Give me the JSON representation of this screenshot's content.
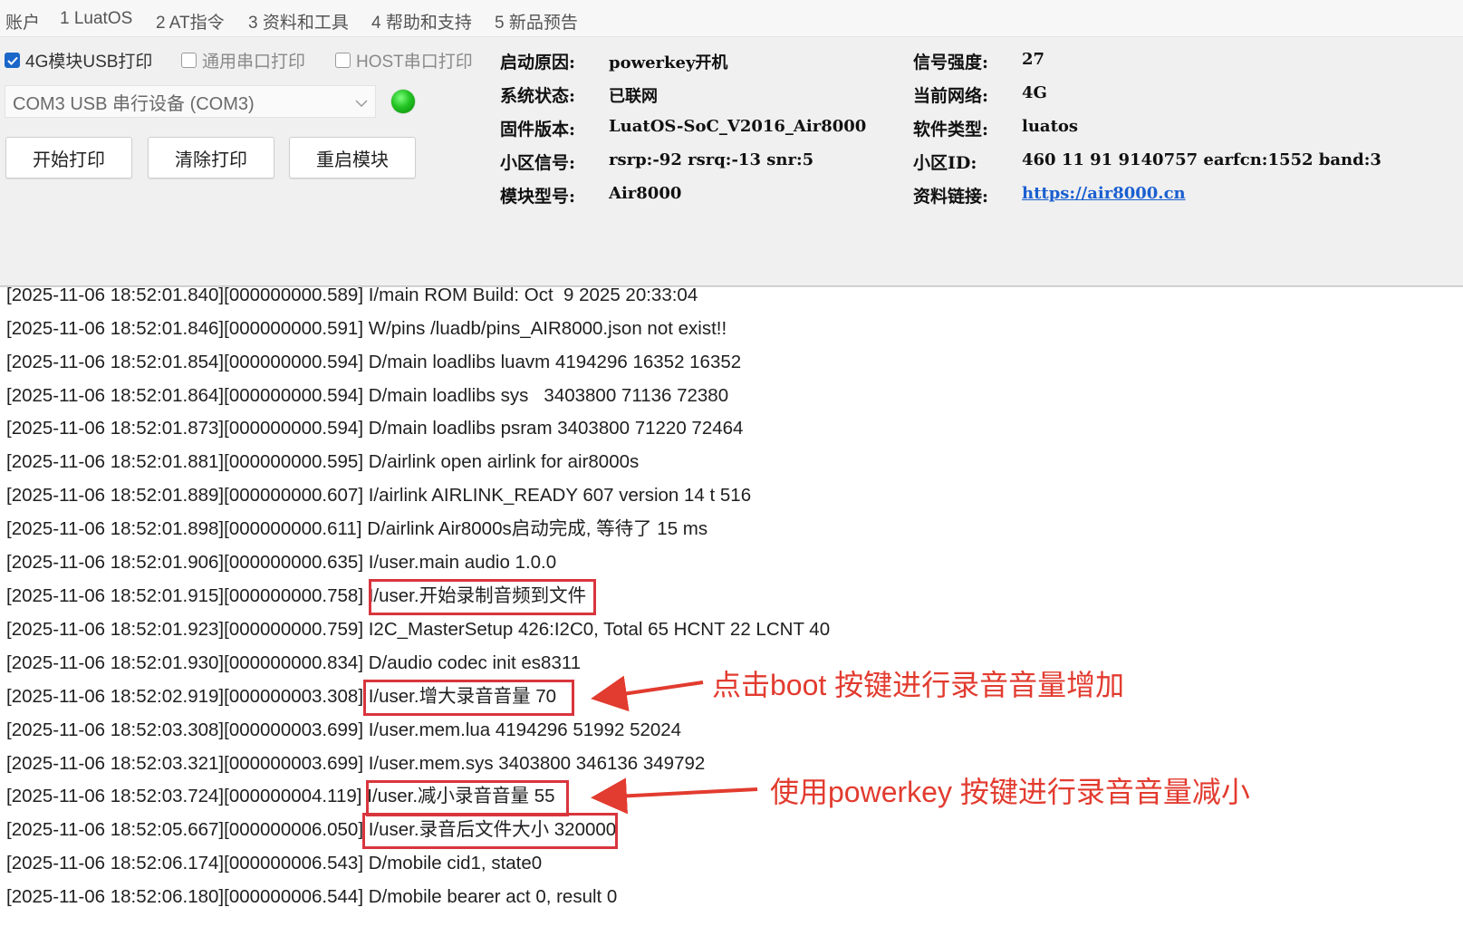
{
  "menu": [
    "账户",
    "1 LuatOS",
    "2 AT指令",
    "3 资料和工具",
    "4 帮助和支持",
    "5 新品预告"
  ],
  "panel": {
    "checkboxes": [
      {
        "label": "4G模块USB打印",
        "checked": true
      },
      {
        "label": "通用串口打印",
        "checked": false
      },
      {
        "label": "HOST串口打印",
        "checked": false
      }
    ],
    "port_select": "COM3 USB 串行设备 (COM3)",
    "led_color": "#22c322",
    "buttons": [
      "开始打印",
      "清除打印",
      "重启模块"
    ]
  },
  "info": {
    "boot_reason": {
      "label": "启动原因:",
      "value": "powerkey开机"
    },
    "system_state": {
      "label": "系统状态:",
      "value": "已联网"
    },
    "firmware": {
      "label": "固件版本:",
      "value": "LuatOS-SoC_V2016_Air8000"
    },
    "cell_signal": {
      "label": "小区信号:",
      "value": "rsrp:-92 rsrq:-13 snr:5"
    },
    "module_model": {
      "label": "模块型号:",
      "value": "Air8000"
    },
    "signal_strength": {
      "label": "信号强度:",
      "value": "27"
    },
    "network": {
      "label": "当前网络:",
      "value": "4G"
    },
    "software_type": {
      "label": "软件类型:",
      "value": "luatos"
    },
    "cell_id": {
      "label": "小区ID:",
      "value": "460 11 91 9140757 earfcn:1552 band:3"
    },
    "docs_link": {
      "label": "资料链接:",
      "value": "https://air8000.cn"
    }
  },
  "log": [
    {
      "prefix": "[2025-11-06 18:52:01.840][000000000.589] ",
      "msg": "I/main ROM Build: Oct  9 2025 20:33:04"
    },
    {
      "prefix": "[2025-11-06 18:52:01.846][000000000.591] ",
      "msg": "W/pins /luadb/pins_AIR8000.json not exist!!"
    },
    {
      "prefix": "[2025-11-06 18:52:01.854][000000000.594] ",
      "msg": "D/main loadlibs luavm 4194296 16352 16352"
    },
    {
      "prefix": "[2025-11-06 18:52:01.864][000000000.594] ",
      "msg": "D/main loadlibs sys   3403800 71136 72380"
    },
    {
      "prefix": "[2025-11-06 18:52:01.873][000000000.594] ",
      "msg": "D/main loadlibs psram 3403800 71220 72464"
    },
    {
      "prefix": "[2025-11-06 18:52:01.881][000000000.595] ",
      "msg": "D/airlink open airlink for air8000s"
    },
    {
      "prefix": "[2025-11-06 18:52:01.889][000000000.607] ",
      "msg": "I/airlink AIRLINK_READY 607 version 14 t 516"
    },
    {
      "prefix": "[2025-11-06 18:52:01.898][000000000.611] ",
      "msg": "D/airlink Air8000s启动完成, 等待了 15 ms"
    },
    {
      "prefix": "[2025-11-06 18:52:01.906][000000000.635] ",
      "msg": "I/user.main audio 1.0.0"
    },
    {
      "prefix": "[2025-11-06 18:52:01.915][000000000.758] ",
      "msg": "I/user.开始录制音频到文件"
    },
    {
      "prefix": "[2025-11-06 18:52:01.923][000000000.759] ",
      "msg": "I2C_MasterSetup 426:I2C0, Total 65 HCNT 22 LCNT 40"
    },
    {
      "prefix": "[2025-11-06 18:52:01.930][000000000.834] ",
      "msg": "D/audio codec init es8311"
    },
    {
      "prefix": "[2025-11-06 18:52:02.919][000000003.308] ",
      "msg": "I/user.增大录音音量 70"
    },
    {
      "prefix": "[2025-11-06 18:52:03.308][000000003.699] ",
      "msg": "I/user.mem.lua 4194296 51992 52024"
    },
    {
      "prefix": "[2025-11-06 18:52:03.321][000000003.699] ",
      "msg": "I/user.mem.sys 3403800 346136 349792"
    },
    {
      "prefix": "[2025-11-06 18:52:03.724][000000004.119] ",
      "msg": "I/user.减小录音音量 55"
    },
    {
      "prefix": "[2025-11-06 18:52:05.667][000000006.050] ",
      "msg": "I/user.录音后文件大小 320000"
    },
    {
      "prefix": "[2025-11-06 18:52:06.174][000000006.543] ",
      "msg": "D/mobile cid1, state0"
    },
    {
      "prefix": "[2025-11-06 18:52:06.180][000000006.544] ",
      "msg": "D/mobile bearer act 0, result 0"
    }
  ],
  "annotations": {
    "boot_key": "点击boot 按键进行录音音量增加",
    "powerkey": "使用powerkey 按键进行录音音量减小"
  },
  "colors": {
    "accent_checkbox": "#1a66c9",
    "highlight_red": "#d9353d",
    "annotation_red": "#e23b2f",
    "link_blue": "#1a5fd0"
  }
}
